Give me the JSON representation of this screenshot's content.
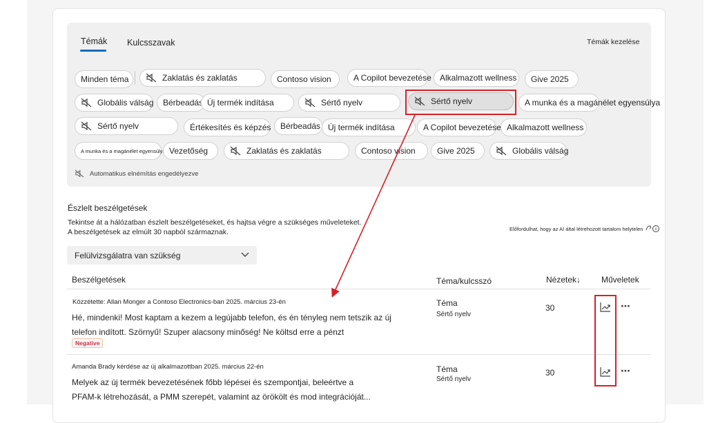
{
  "tabs": [
    "Témák",
    "Kulcsszavak"
  ],
  "manage_topics": "Témák kezelése",
  "topic_chips": [
    {
      "label": "Minden téma",
      "muted": false
    },
    {
      "label": "Zaklatás és zaklatás",
      "muted": true
    },
    {
      "label": "Contoso vision",
      "muted": false
    },
    {
      "label": "A Copilot bevezetése",
      "muted": false
    },
    {
      "label": "Alkalmazott wellness",
      "muted": false
    },
    {
      "label": "Give 2025",
      "muted": false
    },
    {
      "label": "Globális válság",
      "muted": true
    },
    {
      "label": "Bérbeadás",
      "muted": false
    },
    {
      "label": "Új termék indítása",
      "muted": false
    },
    {
      "label": "Sértő nyelv",
      "muted": true
    },
    {
      "label": "Sértő nyelv",
      "muted": true,
      "selected": true
    },
    {
      "label": "A munka és a magánélet egyensúlya",
      "muted": false
    },
    {
      "label": "Sértő nyelv",
      "muted": true
    },
    {
      "label": "Értékesítés és képzés",
      "muted": false
    },
    {
      "label": "Bérbeadás",
      "muted": false
    },
    {
      "label": "Új termék indítása",
      "muted": false
    },
    {
      "label": "A Copilot bevezetése",
      "muted": false
    },
    {
      "label": "Alkalmazott wellness",
      "muted": false
    },
    {
      "label": "A munka és a magánélet egyensúlya",
      "muted": false
    },
    {
      "label": "Vezetőség",
      "muted": false
    },
    {
      "label": "Zaklatás és zaklatás",
      "muted": true
    },
    {
      "label": "Contoso vision",
      "muted": false
    },
    {
      "label": "Give 2025",
      "muted": false
    },
    {
      "label": "Globális válság",
      "muted": true
    }
  ],
  "auto_mute": "Automatikus elnémítás engedélyezve",
  "section": {
    "title": "Észlelt beszélgetések",
    "desc1": "Tekintse át a hálózatban észlelt beszélgetéseket, és hajtsa végre a szükséges műveleteket.",
    "desc2": "A beszélgetések az elmúlt 30 napból származnak.",
    "ai_note": "Előfordulhat, hogy az AI által létrehozott tartalom helytelen"
  },
  "filter": {
    "value": "Felülvizsgálatra van szükség"
  },
  "columns": {
    "conversations": "Beszélgetések",
    "topic": "Téma/kulcsszó",
    "views": "Nézetek↓",
    "actions": "Műveletek"
  },
  "rows": [
    {
      "meta": "Közzétette: Allan Monger a Contoso Electronics-ban 2025. március 23-én",
      "line1": "Hé, mindenki! Most kaptam a kezem a legújabb telefon, és én tényleg nem tetszik az új",
      "line2": "telefon indított. Szörnyű! Szuper alacsony minőség! Ne költsd erre a pénzt",
      "badge": "Negative",
      "topic_type": "Téma",
      "topic_name": "Sértő nyelv",
      "views": "30"
    },
    {
      "meta": "Amanda Brady kérdése az új alkalmazottban 2025. március 22-én",
      "line1": "Melyek az új termék bevezetésének főbb lépései és szempontjai, beleértve a",
      "line2": "PFAM-k létrehozását, a PMM szerepét, valamint az örökölt és mod integrációját...",
      "topic_type": "Téma",
      "topic_name": "Sértő nyelv",
      "views": "30"
    }
  ],
  "colors": {
    "accent": "#0f6cbd",
    "highlight": "#d42027",
    "negative": "#c4314b"
  },
  "icons": [
    "mute-icon",
    "chevron-down-icon",
    "trend-icon",
    "more-icon",
    "ai-info-icon"
  ]
}
